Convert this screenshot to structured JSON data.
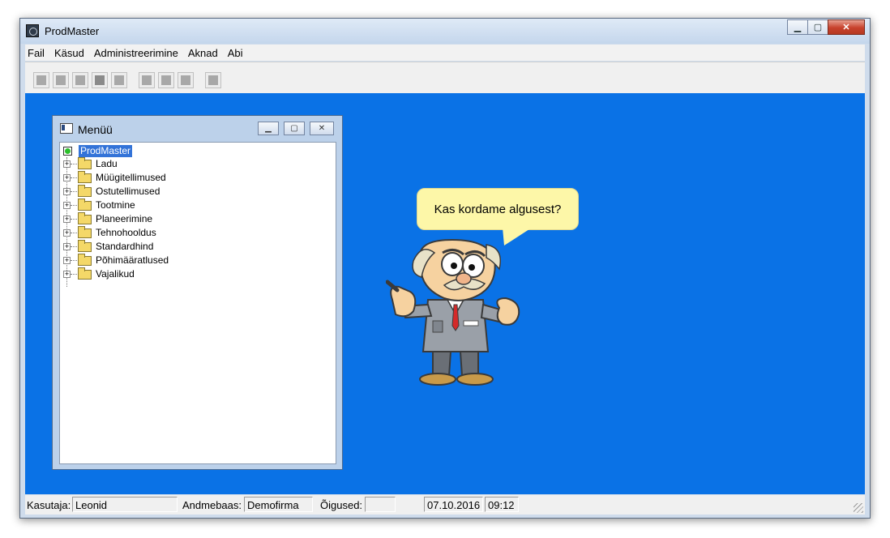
{
  "window": {
    "title": "ProdMaster",
    "controls": {
      "minimize": "▁",
      "maximize": "▢",
      "close": "✕"
    }
  },
  "menubar": {
    "items": [
      "Fail",
      "Käsud",
      "Administreerimine",
      "Aknad",
      "Abi"
    ]
  },
  "toolbar": {
    "buttons": [
      "new-record-icon",
      "find-icon",
      "edit-icon",
      "stop-icon",
      "print-preview-icon",
      "new-item-icon",
      "open-folder-icon",
      "delete-icon",
      "copy-icon"
    ]
  },
  "menu_window": {
    "title": "Menüü",
    "tree": {
      "root": "ProdMaster",
      "items": [
        "Ladu",
        "Müügitellimused",
        "Ostutellimused",
        "Tootmine",
        "Planeerimine",
        "Tehnohooldus",
        "Standardhind",
        "Põhimääratlused",
        "Vajalikud"
      ]
    }
  },
  "assistant": {
    "speech": "Kas kordame algusest?"
  },
  "statusbar": {
    "user_label": "Kasutaja:",
    "user_value": "Leonid",
    "db_label": "Andmebaas:",
    "db_value": "Demofirma",
    "rights_label": "Õigused:",
    "rights_value": "",
    "date": "07.10.2016",
    "time": "09:12"
  },
  "colors": {
    "desktop": "#0a72e6",
    "bubble": "#fdf7a8",
    "selection": "#3373d8"
  }
}
